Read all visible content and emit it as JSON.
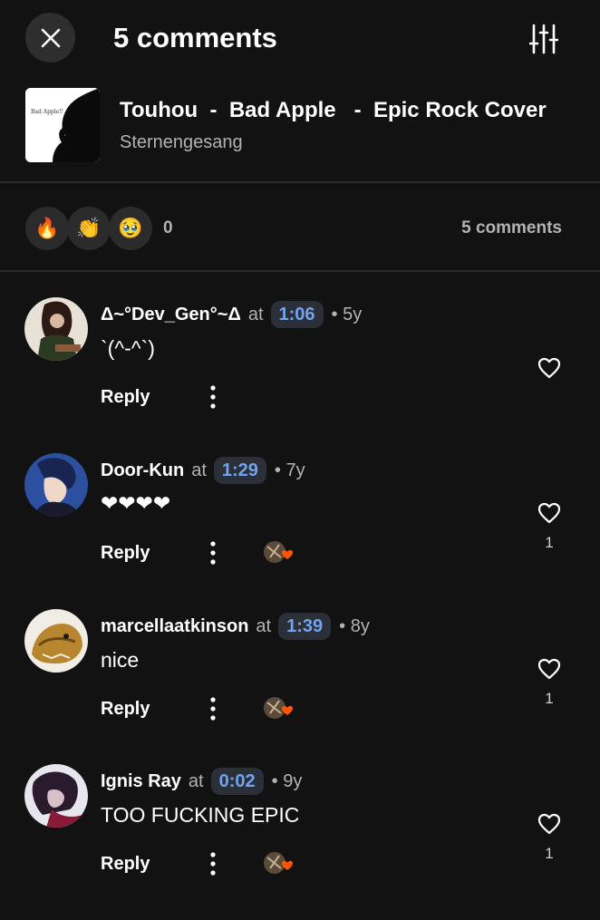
{
  "header": {
    "title": "5 comments"
  },
  "track": {
    "title": "Touhou  -  Bad Apple   -  Epic Rock Cover",
    "artist": "Sternengesang",
    "artwork_text": "Bad Apple!!"
  },
  "reactions": {
    "items": [
      {
        "icon": "fire-emoji",
        "glyph": "🔥"
      },
      {
        "icon": "clapping-hands-emoji",
        "glyph": "👏"
      },
      {
        "icon": "pleading-face-emoji",
        "glyph": "🥹"
      }
    ],
    "count": "0",
    "comments_label": "5 comments"
  },
  "comments": [
    {
      "username": "Δ~°Dev_Gen°~Δ",
      "at": "at",
      "timestamp": "1:06",
      "age": "• 5y",
      "text": "`(^-^`)",
      "reply_label": "Reply",
      "likes": "",
      "creator_liked": false
    },
    {
      "username": "Door-Kun",
      "at": "at",
      "timestamp": "1:29",
      "age": "• 7y",
      "text": "❤❤❤❤",
      "reply_label": "Reply",
      "likes": "1",
      "creator_liked": true
    },
    {
      "username": "marcellaatkinson",
      "at": "at",
      "timestamp": "1:39",
      "age": "• 8y",
      "text": "nice",
      "reply_label": "Reply",
      "likes": "1",
      "creator_liked": true
    },
    {
      "username": "Ignis Ray",
      "at": "at",
      "timestamp": "0:02",
      "age": "• 9y",
      "text": "TOO FUCKING EPIC",
      "reply_label": "Reply",
      "likes": "1",
      "creator_liked": true
    }
  ],
  "colors": {
    "background": "#121212",
    "timestamp": "#71a3ee",
    "creator_heart": "#ff5500",
    "secondary_text": "#b3b3b3"
  }
}
